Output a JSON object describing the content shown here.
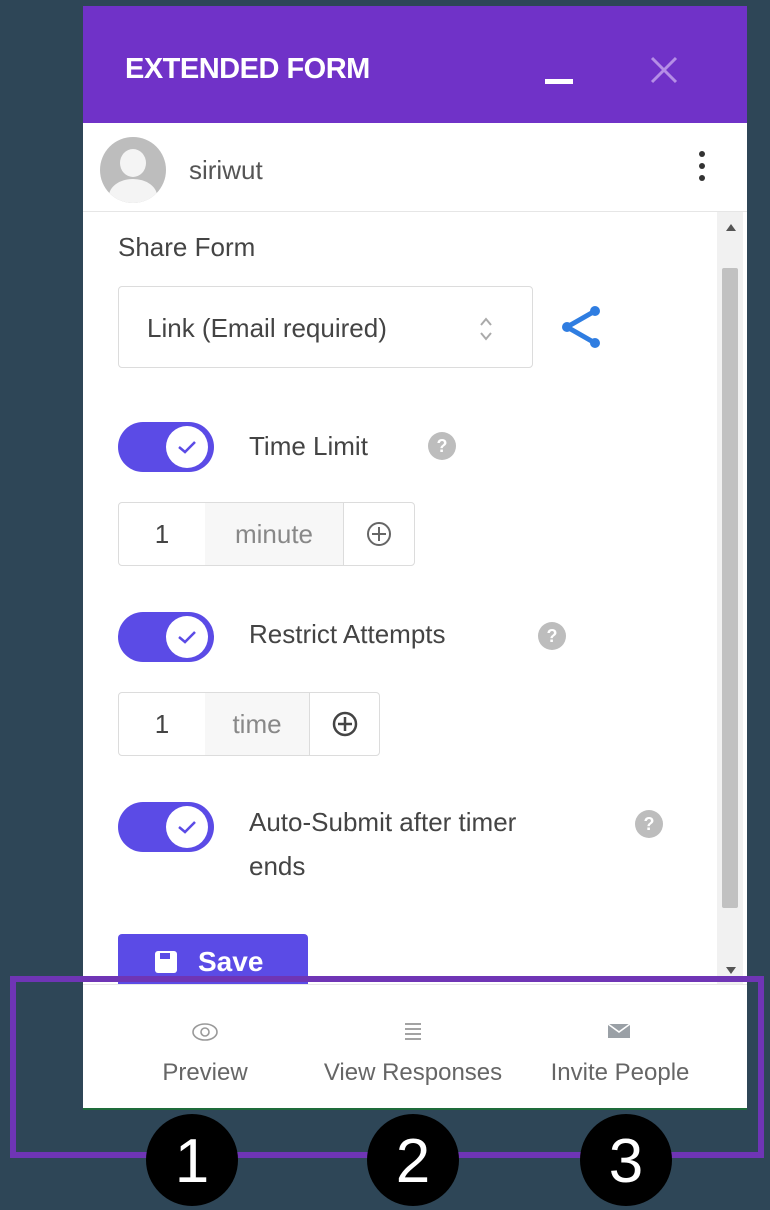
{
  "header": {
    "title": "EXTENDED FORM"
  },
  "user": {
    "name": "siriwut"
  },
  "share": {
    "title": "Share Form",
    "select_value": "Link (Email required)"
  },
  "settings": {
    "time_limit": {
      "label": "Time Limit",
      "enabled": true,
      "value": "1",
      "unit": "minute",
      "help": "?"
    },
    "restrict_attempts": {
      "label": "Restrict Attempts",
      "enabled": true,
      "value": "1",
      "unit": "time",
      "help": "?"
    },
    "auto_submit": {
      "label_line1": "Auto-Submit after timer",
      "label_line2": "ends",
      "enabled": true,
      "help": "?"
    }
  },
  "save_button": {
    "label": "Save"
  },
  "bottom_nav": [
    {
      "label": "Preview",
      "icon": "eye-icon"
    },
    {
      "label": "View Responses",
      "icon": "list-icon"
    },
    {
      "label": "Invite People",
      "icon": "envelope-icon"
    }
  ],
  "markers": [
    "1",
    "2",
    "3"
  ],
  "colors": {
    "header": "#7032c8",
    "accent": "#5b4be6",
    "background": "#2e4657",
    "highlight": "#6f35b5"
  }
}
